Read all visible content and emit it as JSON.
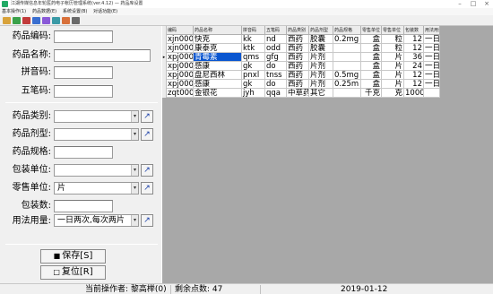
{
  "window": {
    "title": "江湖传媒信息年轮医药电子帐历管理系统(ver.4.12) — 药品库设置",
    "controls": [
      "–",
      "□",
      "×"
    ]
  },
  "menu": [
    "基本操作(1)",
    "药品数据(E)",
    "系统设置(B)",
    "对话功能(E)"
  ],
  "toolbar": {
    "icons": [
      "folder-icon",
      "leaf-icon",
      "pill-icon",
      "chart-icon",
      "user-icon",
      "database-icon",
      "report-icon",
      "tools-icon"
    ],
    "colors": [
      "#d8a23a",
      "#3aa14a",
      "#c23b3b",
      "#3a6fd0",
      "#8a5ad8",
      "#3a9aa6",
      "#d8703a",
      "#6a6a6a"
    ]
  },
  "form": {
    "code_label": "药品编码:",
    "code_value": "",
    "name_label": "药品名称:",
    "name_value": "",
    "pinyin_label": "拼音码:",
    "pinyin_value": "",
    "wubi_label": "五笔码:",
    "wubi_value": "",
    "category_label": "药品类别:",
    "category_value": "",
    "form_type_label": "药品剂型:",
    "form_type_value": "",
    "spec_label": "药品规格:",
    "spec_value": "",
    "pack_unit_label": "包装单位:",
    "pack_unit_value": "",
    "retail_unit_label": "零售单位:",
    "retail_unit_value": "片",
    "pack_qty_label": "包装数:",
    "pack_qty_value": "",
    "usage_label": "用法用量:",
    "usage_value": "一日两次,每次两片",
    "save_label": "保存[S]",
    "reset_label": "复位[R]"
  },
  "table": {
    "headers": [
      "编码",
      "药品名称",
      "拼音码",
      "五笔码",
      "药品类别",
      "药品剂型",
      "药品规格",
      "零售单位",
      "零售单位",
      "包装数",
      "用法用量"
    ],
    "rows": [
      [
        "xjn0001",
        "快克",
        "kk",
        "nd",
        "西药",
        "胶囊",
        "0.2mg",
        "盒",
        "粒",
        "12",
        "一日"
      ],
      [
        "xjn0002",
        "康泰克",
        "ktk",
        "odd",
        "西药",
        "胶囊",
        "",
        "盒",
        "粒",
        "12",
        "一日"
      ],
      [
        "xpj0003",
        "青霉素",
        "qms",
        "gfg",
        "西药",
        "片剂",
        "",
        "盒",
        "片",
        "36",
        "一日"
      ],
      [
        "xpj0004",
        "感康",
        "gk",
        "do",
        "西药",
        "片剂",
        "",
        "盒",
        "片",
        "24",
        "一日"
      ],
      [
        "xpj0005",
        "盘尼西林",
        "pnxl",
        "tnss",
        "西药",
        "片剂",
        "0.5mg",
        "盒",
        "片",
        "12",
        "一日"
      ],
      [
        "xpj0006",
        "感康",
        "gk",
        "do",
        "西药",
        "片剂",
        "0.25m",
        "盒",
        "片",
        "12",
        "一日"
      ],
      [
        "zqt0007",
        "金银花",
        "jyh",
        "qqa",
        "中草药",
        "其它",
        "",
        "千克",
        "克",
        "1000",
        ""
      ]
    ],
    "selected_row": 2,
    "selected_col": 1,
    "selected_color": "#0a56d0"
  },
  "status": {
    "operator": "当前操作者: 黎高榉(0)",
    "points": "剩余点数: 47",
    "date": "2019-01-12"
  }
}
